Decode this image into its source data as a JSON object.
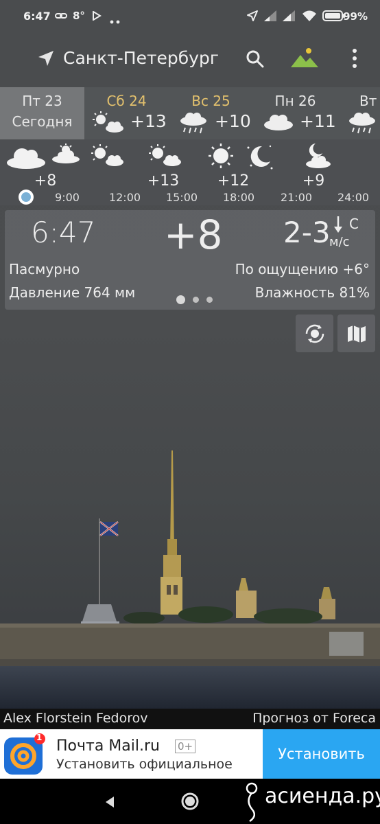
{
  "status_bar": {
    "time": "6:47",
    "temp": "8°",
    "battery": "99%",
    "icons": [
      "link-icon",
      "play-icon",
      "more-dots-icon",
      "location-icon",
      "signal-icon",
      "signal-icon",
      "wifi-icon",
      "battery-icon"
    ]
  },
  "header": {
    "city": "Санкт-Петербург",
    "icons": [
      "location-arrow-icon",
      "search-icon",
      "landscape-icon",
      "more-vert-icon"
    ]
  },
  "days": [
    {
      "name": "Пт 23",
      "sub": "Сегодня",
      "temp": "",
      "selected": true,
      "weekend": false,
      "icon": ""
    },
    {
      "name": "Сб 24",
      "sub": "",
      "temp": "+13",
      "selected": false,
      "weekend": true,
      "icon": "partly-cloudy-icon"
    },
    {
      "name": "Вс 25",
      "sub": "",
      "temp": "+10",
      "selected": false,
      "weekend": true,
      "icon": "rain-cloud-icon"
    },
    {
      "name": "Пн 26",
      "sub": "",
      "temp": "+11",
      "selected": false,
      "weekend": false,
      "icon": "cloud-icon"
    },
    {
      "name": "Вт",
      "sub": "",
      "temp": "",
      "selected": false,
      "weekend": false,
      "icon": "rain-cloud-icon"
    }
  ],
  "hourly": {
    "temps": [
      "+8",
      "+13",
      "+12",
      "+9"
    ],
    "times": [
      "9:00",
      "12:00",
      "15:00",
      "18:00",
      "21:00",
      "24:00"
    ],
    "icons": [
      "cloud-icon",
      "partly-cloudy-icon",
      "partly-cloudy-icon",
      "partly-cloudy-icon",
      "sun-icon",
      "moon-icon",
      "moon-cloud-icon"
    ]
  },
  "current": {
    "time": "6:47",
    "temp": "+8",
    "wind": "2-3",
    "wind_dir": "С",
    "wind_unit": "м/с",
    "condition": "Пасмурно",
    "feels": "По ощущению +6°",
    "pressure": "Давление 764 мм",
    "humidity": "Влажность 81%"
  },
  "buttons": {
    "icons": [
      "sun-rotate-icon",
      "map-icon"
    ]
  },
  "credits": {
    "photo": "Alex Florstein Fedorov",
    "source": "Прогноз от Foreca"
  },
  "ad": {
    "badge": "1",
    "name": "Почта Mail.ru",
    "age": "0+",
    "desc": "Установить официальное",
    "button": "Установить"
  },
  "watermark": "асиенда.ру",
  "colors": {
    "accent_weekend": "#e2c06d",
    "install": "#2aa6f2",
    "now_dot": "#7bb1d6"
  }
}
